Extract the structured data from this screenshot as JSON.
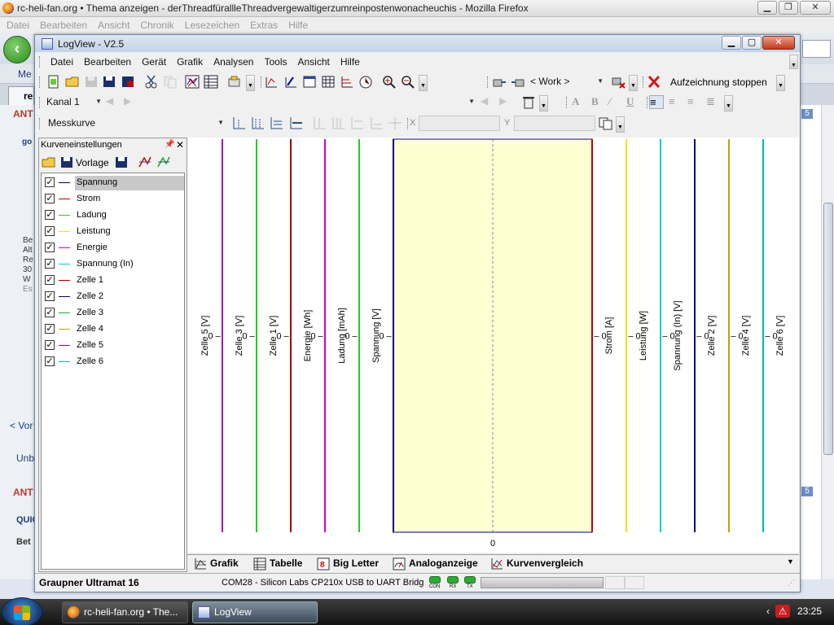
{
  "firefox": {
    "title": "rc-heli-fan.org • Thema anzeigen - derThreadfürallleThreadvergewaltigerzumreinpostenwonacheuchis - Mozilla Firefox",
    "menu": [
      "Datei",
      "Bearbeiten",
      "Ansicht",
      "Chronik",
      "Lesezeichen",
      "Extras",
      "Hilfe"
    ],
    "bookmark_fragment": "Me",
    "tab_fragment": "re",
    "page_fragments": [
      "ANT",
      "go",
      "Be",
      "Alt",
      "Re",
      "30",
      "W",
      "Es",
      "< Vor",
      "Unb",
      "ANT",
      "QUIC",
      "Bet"
    ],
    "badge": "5"
  },
  "taskbar": {
    "buttons": [
      "rc-heli-fan.org • The...",
      "LogView"
    ],
    "clock": "23:25"
  },
  "logview": {
    "title": "LogView - V2.5",
    "menu": [
      "Datei",
      "Bearbeiten",
      "Gerät",
      "Grafik",
      "Analysen",
      "Tools",
      "Ansicht",
      "Hilfe"
    ],
    "work_combo": "< Work >",
    "stop_label": "Aufzeichnung stoppen",
    "channel_combo": "Kanal 1",
    "curve_combo": "Messkurve",
    "x_label": "X",
    "y_label": "Y",
    "panel": {
      "title": "Kurveneinstellungen",
      "template_label": "Vorlage",
      "curves": [
        {
          "name": "Spannung",
          "color": "#000080",
          "checked": true,
          "selected": true
        },
        {
          "name": "Strom",
          "color": "#c00000",
          "checked": true
        },
        {
          "name": "Ladung",
          "color": "#22cc22",
          "checked": true
        },
        {
          "name": "Leistung",
          "color": "#e8e800",
          "checked": true
        },
        {
          "name": "Energie",
          "color": "#cc00cc",
          "checked": true
        },
        {
          "name": "Spannung (In)",
          "color": "#00cccc",
          "checked": true
        },
        {
          "name": "Zelle 1",
          "color": "#a00000",
          "checked": true
        },
        {
          "name": "Zelle 2",
          "color": "#000080",
          "checked": true
        },
        {
          "name": "Zelle 3",
          "color": "#22aa22",
          "checked": true
        },
        {
          "name": "Zelle 4",
          "color": "#c8a000",
          "checked": true
        },
        {
          "name": "Zelle 5",
          "color": "#aa00aa",
          "checked": true
        },
        {
          "name": "Zelle 6",
          "color": "#00bbbb",
          "checked": true
        }
      ]
    },
    "bottom_tabs": [
      "Grafik",
      "Tabelle",
      "Big Letter",
      "Analoganzeige",
      "Kurvenvergleich"
    ],
    "status": {
      "device": "Graupner Ultramat 16",
      "port": "COM28  -  Silicon Labs CP210x USB to UART Bridg",
      "leds": [
        "CON",
        "RX",
        "TX"
      ]
    }
  },
  "chart_data": {
    "type": "line",
    "x_tick": "0",
    "left_axes": [
      {
        "label": "Zelle 5  [V]",
        "color": "#aa00aa",
        "tick": "0"
      },
      {
        "label": "Zelle 3  [V]",
        "color": "#22cc22",
        "tick": "0"
      },
      {
        "label": "Zelle 1  [V]",
        "color": "#a00000",
        "tick": "0"
      },
      {
        "label": "Energie  [Wh]",
        "color": "#cc00cc",
        "tick": "0"
      },
      {
        "label": "Ladung  [mAh]",
        "color": "#22cc22",
        "tick": "0"
      },
      {
        "label": "Spannung  [V]",
        "color": "#000080",
        "tick": "0"
      }
    ],
    "right_axes": [
      {
        "label": "Strom  [A]",
        "color": "#c00000",
        "tick": "0"
      },
      {
        "label": "Leistung  [W]",
        "color": "#e8e800",
        "tick": "0"
      },
      {
        "label": "Spannung (In)  [V]",
        "color": "#00cccc",
        "tick": "0"
      },
      {
        "label": "Zelle 2  [V]",
        "color": "#000080",
        "tick": "0"
      },
      {
        "label": "Zelle 4  [V]",
        "color": "#c8a000",
        "tick": "0"
      },
      {
        "label": "Zelle 6  [V]",
        "color": "#00bbbb",
        "tick": "0"
      }
    ],
    "plot_background": "#ffffd4",
    "series": []
  }
}
